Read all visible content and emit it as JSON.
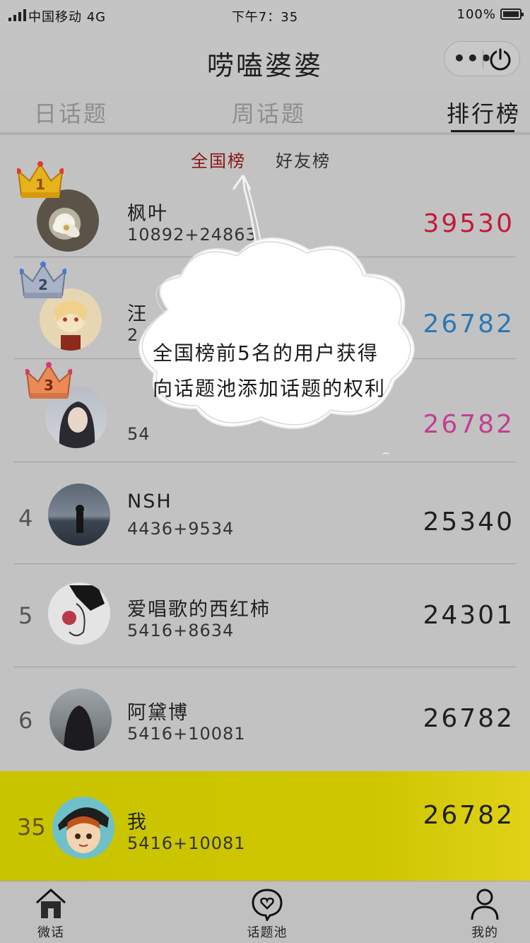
{
  "status_bar": {
    "carrier": "中国移动 4G",
    "time": "下午7：35",
    "battery": "100%"
  },
  "nav": {
    "title": "唠嗑婆婆",
    "more_icon": "more-dots-icon",
    "power_icon": "power-icon"
  },
  "tabs": [
    {
      "label": "日话题",
      "active": false
    },
    {
      "label": "周话题",
      "active": false
    },
    {
      "label": "排行榜",
      "active": true
    }
  ],
  "subtabs": [
    {
      "label": "全国榜",
      "active": true
    },
    {
      "label": "好友榜",
      "active": false
    }
  ],
  "rankings": [
    {
      "rank": "",
      "badge": "crown-gold-1-icon",
      "name": "枫叶",
      "detail": "10892+24863",
      "score": "39530",
      "score_color": "#c41937"
    },
    {
      "rank": "",
      "badge": "crown-silver-2-icon",
      "name": "汪",
      "detail": "2",
      "score": "26782",
      "score_color": "#2a78b4"
    },
    {
      "rank": "",
      "badge": "crown-bronze-3-icon",
      "name": "",
      "detail": "54",
      "score": "26782",
      "score_color": "#c13f94"
    },
    {
      "rank": "4",
      "badge": "",
      "name": "NSH",
      "detail": "4436+9534",
      "score": "25340",
      "score_color": "#1f1f1f"
    },
    {
      "rank": "5",
      "badge": "",
      "name": "爱唱歌的西红柿",
      "detail": "5416+8634",
      "score": "24301",
      "score_color": "#1f1f1f"
    },
    {
      "rank": "6",
      "badge": "",
      "name": "阿黛博",
      "detail": "5416+10081",
      "score": "26782",
      "score_color": "#1f1f1f"
    }
  ],
  "me": {
    "rank": "35",
    "name": "我",
    "detail": "5416+10081",
    "score": "26782"
  },
  "tooltip": {
    "line1": "全国榜前5名的用户获得",
    "line2": "向话题池添加话题的权利"
  },
  "bottom_nav": [
    {
      "label": "微话",
      "icon": "home-icon"
    },
    {
      "label": "话题池",
      "icon": "heart-bubble-icon"
    },
    {
      "label": "我的",
      "icon": "user-icon"
    }
  ]
}
